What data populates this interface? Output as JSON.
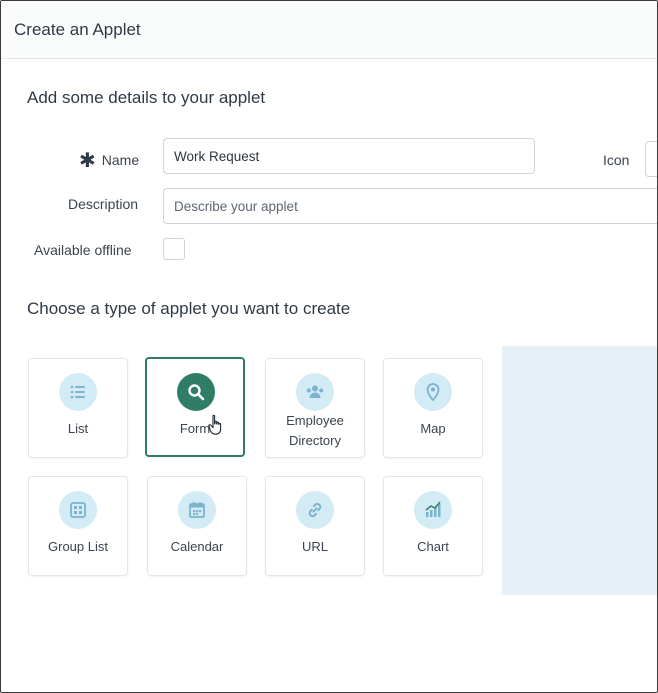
{
  "dialog": {
    "title": "Create an Applet"
  },
  "details": {
    "heading": "Add some details to your applet",
    "name_label": "Name",
    "name_value": "Work Request",
    "icon_label": "Icon",
    "description_label": "Description",
    "description_placeholder": "Describe your applet",
    "offline_label": "Available offline"
  },
  "types": {
    "heading": "Choose a type of applet you want to create",
    "items": [
      {
        "label": "List",
        "icon": "list-icon",
        "selected": false
      },
      {
        "label": "Form",
        "icon": "search-icon",
        "selected": true
      },
      {
        "label": "Employee Directory",
        "icon": "people-icon",
        "selected": false
      },
      {
        "label": "Map",
        "icon": "map-pin-icon",
        "selected": false
      },
      {
        "label": "Group List",
        "icon": "grid-icon",
        "selected": false
      },
      {
        "label": "Calendar",
        "icon": "calendar-icon",
        "selected": false
      },
      {
        "label": "URL",
        "icon": "link-icon",
        "selected": false
      },
      {
        "label": "Chart",
        "icon": "chart-icon",
        "selected": false
      }
    ]
  },
  "colors": {
    "accent": "#2f7d66",
    "icon_bg": "#d3ebf4",
    "preview_bg": "#e5f1f7"
  }
}
